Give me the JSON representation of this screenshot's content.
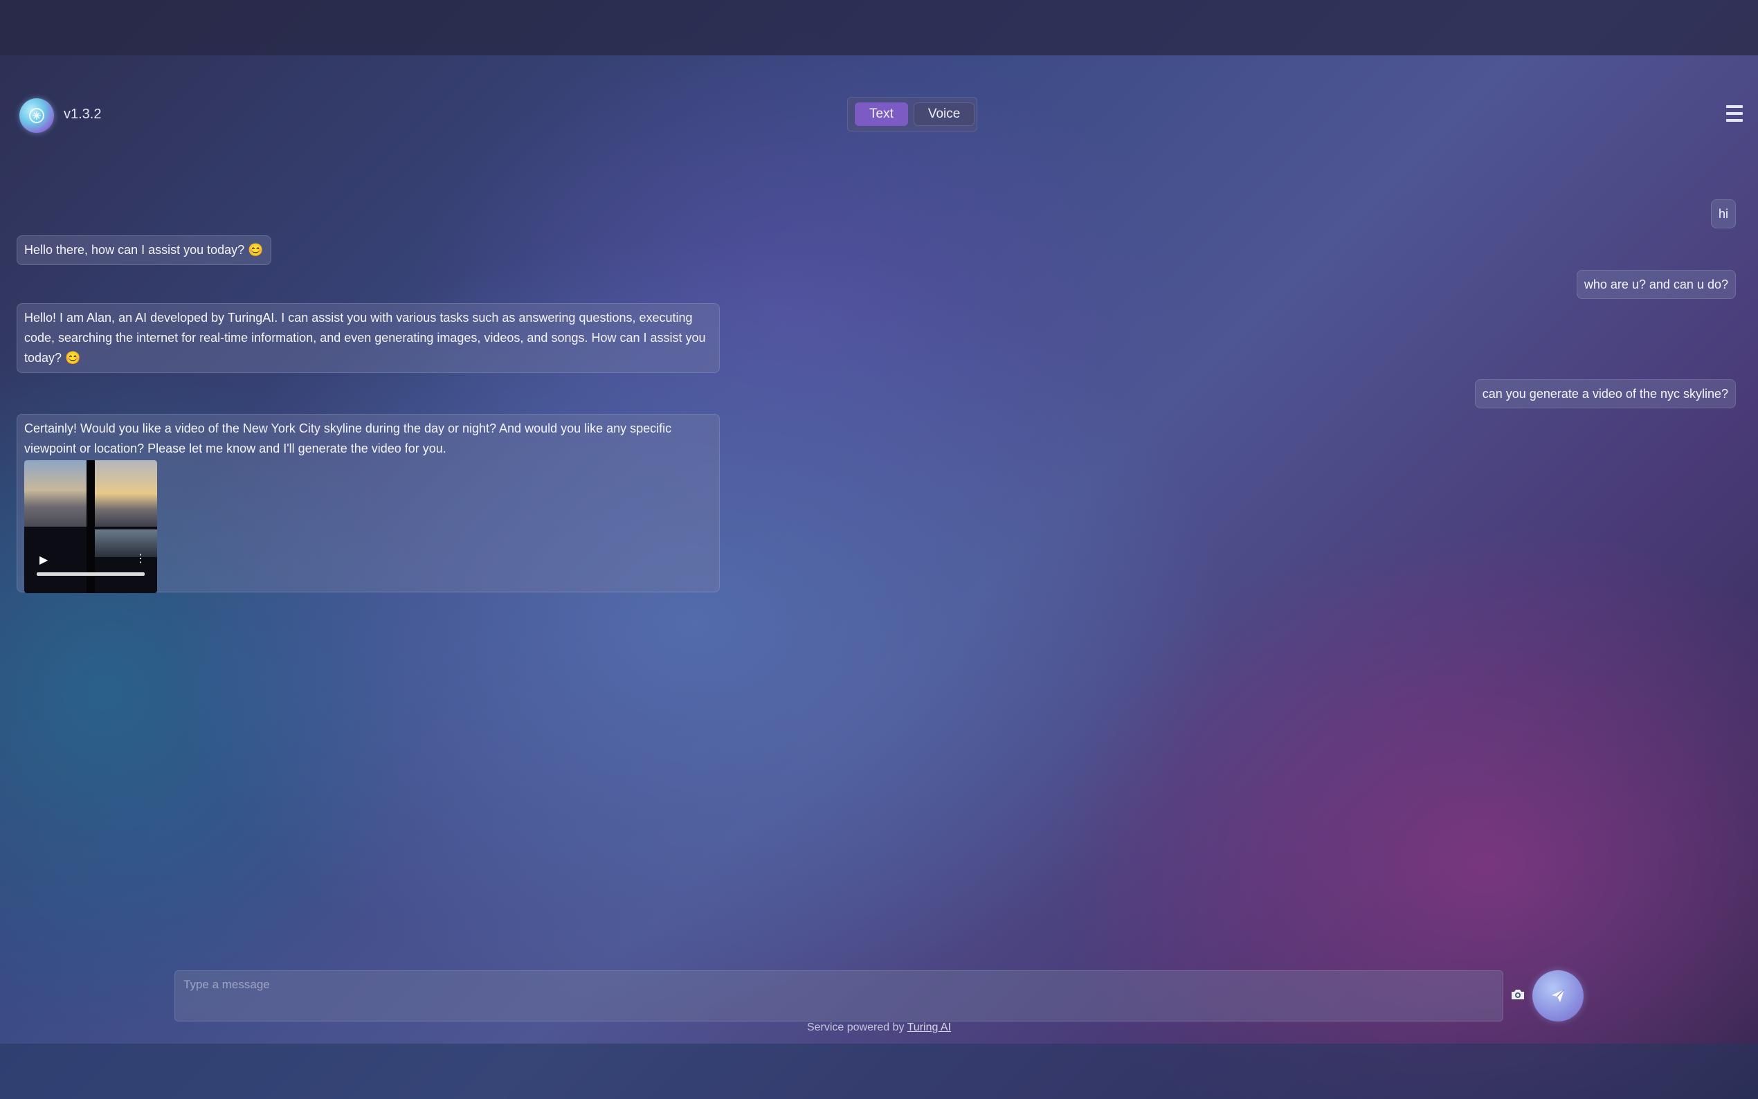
{
  "header": {
    "version": "v1.3.2",
    "modes": [
      {
        "label": "Text",
        "active": true
      },
      {
        "label": "Voice",
        "active": false
      }
    ]
  },
  "messages": {
    "user": [
      "hi",
      "who are u? and can u do?",
      "can you generate a video of the nyc skyline?"
    ],
    "assistant": [
      "Hello there, how can I assist you today? 😊",
      "Hello! I am Alan, an AI developed by TuringAI. I can assist you with various tasks such as answering questions, executing code, searching the internet for real-time information, and even generating images, videos, and songs. How can I assist you today? 😊",
      "Certainly! Would you like a video of the New York City skyline during the day or night? And would you like any specific viewpoint or location? Please let me know and I'll generate the video for you."
    ]
  },
  "composer": {
    "placeholder": "Type a message"
  },
  "footer": {
    "prefix": "Service powered by ",
    "link": "Turing AI"
  },
  "icons": {
    "logo": "logo-icon",
    "menu": "menu-icon",
    "camera": "camera-icon",
    "send": "send-icon",
    "play": "play-icon",
    "more": "more-icon"
  },
  "colors": {
    "accent": "#7c5cc4"
  }
}
